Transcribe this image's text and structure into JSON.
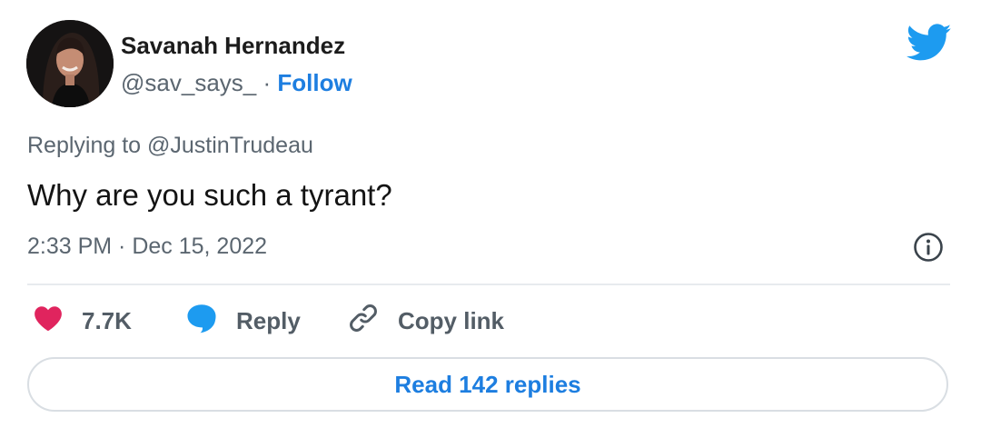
{
  "author": {
    "name": "Savanah Hernandez",
    "handle": "@sav_says_",
    "separator": "·",
    "follow_label": "Follow"
  },
  "tweet": {
    "replying_to": "Replying to @JustinTrudeau",
    "text": "Why are you such a tyrant?",
    "timestamp": "2:33 PM · Dec 15, 2022"
  },
  "actions": {
    "like_count": "7.7K",
    "reply_label": "Reply",
    "copy_link_label": "Copy link"
  },
  "read_replies_label": "Read 142 replies",
  "icons": {
    "brand": "twitter-bird-icon",
    "like": "heart-icon",
    "reply": "speech-bubble-icon",
    "copy": "link-icon",
    "info": "info-icon"
  },
  "colors": {
    "accent": "#1d7ee0",
    "brand": "#1d9bf0",
    "like": "#e0245e",
    "text": "#141414",
    "muted": "#5b6670"
  }
}
